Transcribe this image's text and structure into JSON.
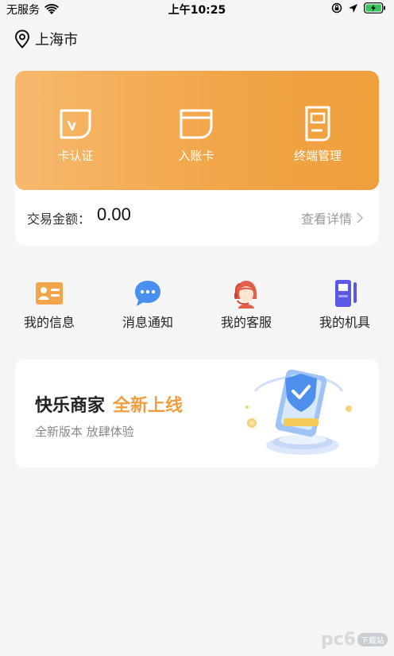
{
  "status_bar": {
    "carrier": "无服务",
    "time": "上午10:25",
    "icons": [
      "wifi-icon",
      "orientation-lock-icon",
      "location-arrow-icon",
      "battery-charging-icon"
    ]
  },
  "location": {
    "city": "上海市",
    "icon": "map-pin-icon"
  },
  "actions": [
    {
      "label": "卡认证",
      "icon": "card-verify-icon"
    },
    {
      "label": "入账卡",
      "icon": "deposit-card-icon"
    },
    {
      "label": "终端管理",
      "icon": "terminal-icon"
    }
  ],
  "amount": {
    "label": "交易金额：",
    "value": "0.00",
    "details": "查看详情"
  },
  "menu": [
    {
      "label": "我的信息",
      "icon": "id-card-icon"
    },
    {
      "label": "消息通知",
      "icon": "chat-bubble-icon"
    },
    {
      "label": "我的客服",
      "icon": "customer-service-icon"
    },
    {
      "label": "我的机具",
      "icon": "pos-device-icon"
    }
  ],
  "banner": {
    "title": "快乐商家",
    "highlight": "全新上线",
    "subtitle": "全新版本 放肆体验"
  },
  "watermark": {
    "text": "pc6",
    "sub": "下载站"
  },
  "colors": {
    "orange_start": "#f6b96e",
    "orange_end": "#ef9f3c",
    "highlight": "#ef9d3e",
    "background": "#f5f5f5"
  }
}
